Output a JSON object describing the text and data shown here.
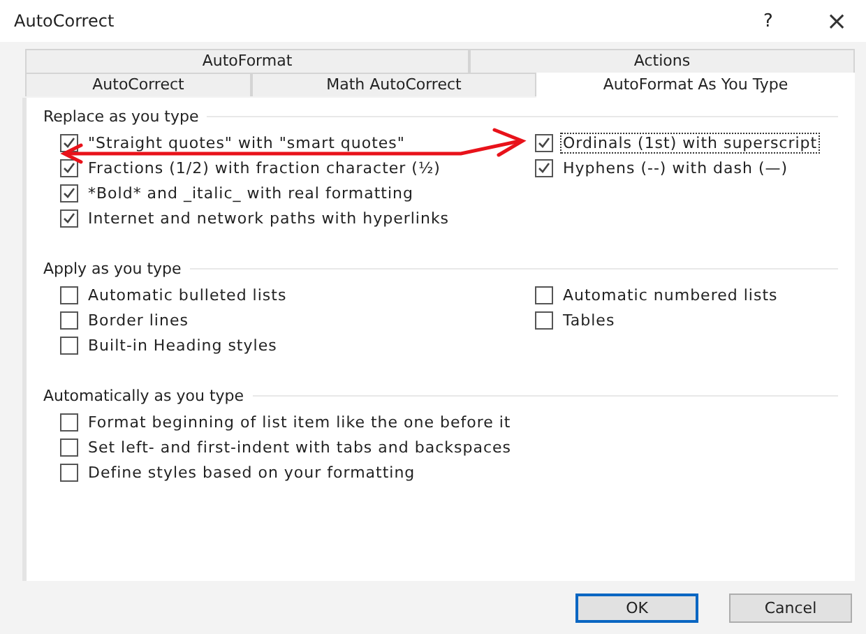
{
  "window": {
    "title": "AutoCorrect",
    "help": "?",
    "close": "×"
  },
  "tab_rows": [
    [
      {
        "label": "AutoFormat",
        "selected": false
      },
      {
        "label": "Actions",
        "selected": false
      }
    ],
    [
      {
        "label": "AutoCorrect",
        "selected": false
      },
      {
        "label": "Math AutoCorrect",
        "selected": false
      },
      {
        "label": "AutoFormat As You Type",
        "selected": true
      }
    ]
  ],
  "sections": [
    {
      "title": "Replace as you type",
      "left": [
        {
          "label": "\"Straight quotes\" with \"smart quotes\"",
          "checked": true,
          "focused": false
        },
        {
          "label": "Fractions (1/2) with fraction character (½)",
          "checked": true,
          "focused": false
        },
        {
          "label": "*Bold* and _italic_ with real formatting",
          "checked": true,
          "focused": false
        },
        {
          "label": "Internet and network paths with hyperlinks",
          "checked": true,
          "focused": false
        }
      ],
      "right": [
        {
          "label": "Ordinals (1st) with superscript",
          "checked": true,
          "focused": true
        },
        {
          "label": "Hyphens (--) with dash (—)",
          "checked": true,
          "focused": false
        }
      ]
    },
    {
      "title": "Apply as you type",
      "left": [
        {
          "label": "Automatic bulleted lists",
          "checked": false,
          "focused": false
        },
        {
          "label": "Border lines",
          "checked": false,
          "focused": false
        },
        {
          "label": "Built-in Heading styles",
          "checked": false,
          "focused": false
        }
      ],
      "right": [
        {
          "label": "Automatic numbered lists",
          "checked": false,
          "focused": false
        },
        {
          "label": "Tables",
          "checked": false,
          "focused": false
        }
      ]
    },
    {
      "title": "Automatically as you type",
      "left": [
        {
          "label": "Format beginning of list item like the one before it",
          "checked": false,
          "focused": false
        },
        {
          "label": "Set left- and first-indent with tabs and backspaces",
          "checked": false,
          "focused": false
        },
        {
          "label": "Define styles based on your formatting",
          "checked": false,
          "focused": false
        }
      ]
    }
  ],
  "buttons": [
    {
      "label": "OK",
      "default": true
    },
    {
      "label": "Cancel",
      "default": false
    }
  ]
}
